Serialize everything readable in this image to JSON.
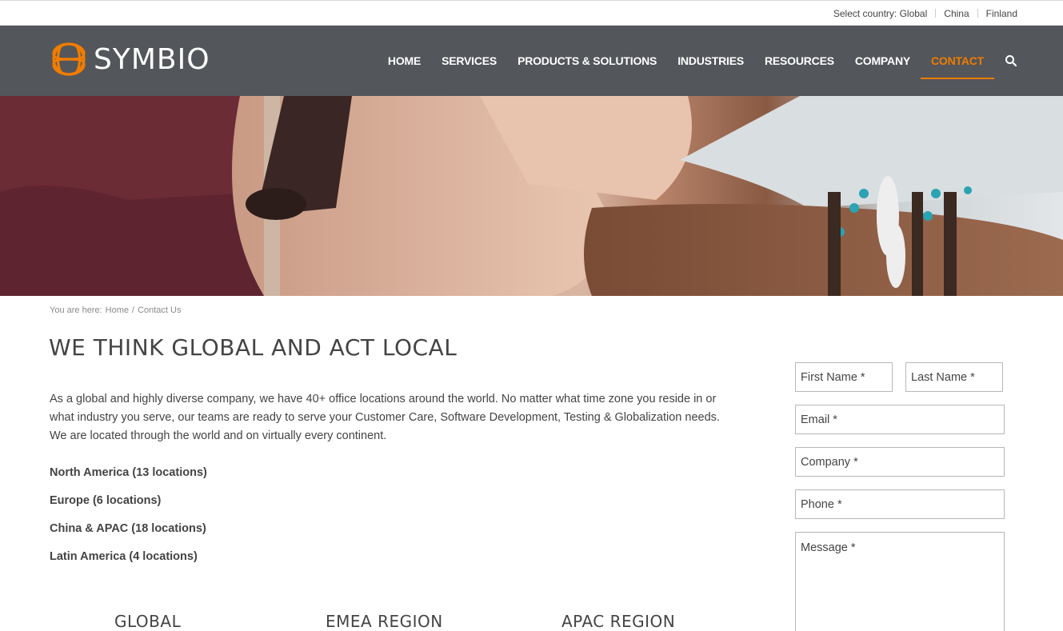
{
  "topbar": {
    "select_label": "Select country: Global",
    "countries": [
      "China",
      "Finland"
    ]
  },
  "header": {
    "logo_text": "SYMBIO",
    "nav": [
      "HOME",
      "SERVICES",
      "PRODUCTS & SOLUTIONS",
      "INDUSTRIES",
      "RESOURCES",
      "COMPANY",
      "CONTACT"
    ],
    "active_nav": "CONTACT",
    "accent_color": "#f07c00",
    "header_bg": "#53565a",
    "search_icon": "search-icon"
  },
  "breadcrumb": {
    "prefix": "You are here:",
    "home": "Home",
    "separator": "/",
    "current": "Contact Us"
  },
  "main": {
    "title": "WE THINK GLOBAL AND ACT LOCAL",
    "intro": "As a global and highly diverse company, we have 40+ office locations around the world. No matter what time zone you reside in or what industry you serve, our teams are ready to serve your Customer Care, Software Development, Testing & Globalization needs. We are located through the world and on virtually every continent.",
    "regions": [
      "North America (13 locations)",
      "Europe (6 locations)",
      "China & APAC (18 locations)",
      "Latin America (4 locations)"
    ],
    "region_headings": [
      "GLOBAL",
      "EMEA REGION",
      "APAC REGION"
    ]
  },
  "form": {
    "first_name": "First Name  *",
    "last_name": "Last Name  *",
    "email": "Email *",
    "company": "Company *",
    "phone": "Phone *",
    "message": "Message *"
  }
}
